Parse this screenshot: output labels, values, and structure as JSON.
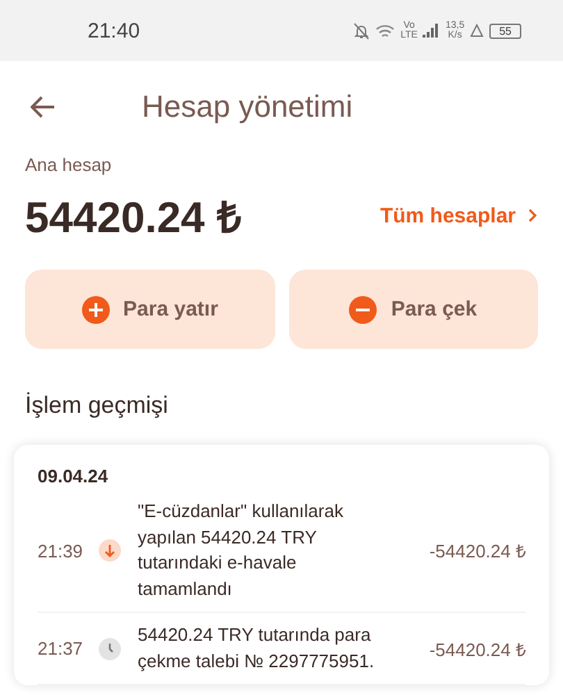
{
  "status_bar": {
    "time": "21:40",
    "network_type": "Vo\nLTE",
    "speed": "13,5\nK/s",
    "battery": "55"
  },
  "header": {
    "title": "Hesap yönetimi"
  },
  "account": {
    "label": "Ana hesap",
    "balance": "54420.24 ₺",
    "all_accounts_link": "Tüm hesaplar"
  },
  "actions": [
    {
      "kind": "deposit",
      "label": "Para yatır"
    },
    {
      "kind": "withdraw",
      "label": "Para çek"
    }
  ],
  "history": {
    "title": "İşlem geçmişi",
    "date": "09.04.24",
    "transactions": [
      {
        "kind": "completed",
        "time": "21:39",
        "description": "\"E-cüzdanlar\" kullanılarak yapılan 54420.24 TRY tutarındaki e-havale tamamlandı",
        "amount": "-54420.24 ₺"
      },
      {
        "kind": "pending",
        "time": "21:37",
        "description": "54420.24 TRY tutarında para çekme talebi № 2297775951.",
        "amount": "-54420.24 ₺"
      }
    ]
  }
}
